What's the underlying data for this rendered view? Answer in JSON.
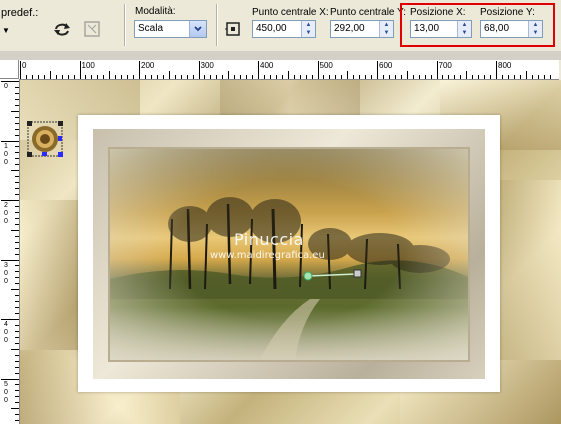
{
  "toolbar": {
    "preset_label": "predef.:",
    "mode_label": "Modalità:",
    "mode_value": "Scala",
    "center_x_label": "Punto centrale X:",
    "center_x_value": "450,00",
    "center_y_label": "Punto centrale Y:",
    "center_y_value": "292,00",
    "pos_x_label": "Posizione X:",
    "pos_x_value": "13,00",
    "pos_y_label": "Posizione Y:",
    "pos_y_value": "68,00",
    "highlight_color": "#e00000"
  },
  "ruler": {
    "h_labels": [
      "0",
      "100",
      "200",
      "300",
      "400",
      "500",
      "600",
      "700",
      "800"
    ],
    "v_labels": [
      "0",
      "1 0 0",
      "2 0 0",
      "3 0 0",
      "4 0 0",
      "5 0 0"
    ]
  },
  "canvas": {
    "watermark_title": "Pinuccia",
    "watermark_url": "www.maidiregrafica.eu"
  }
}
